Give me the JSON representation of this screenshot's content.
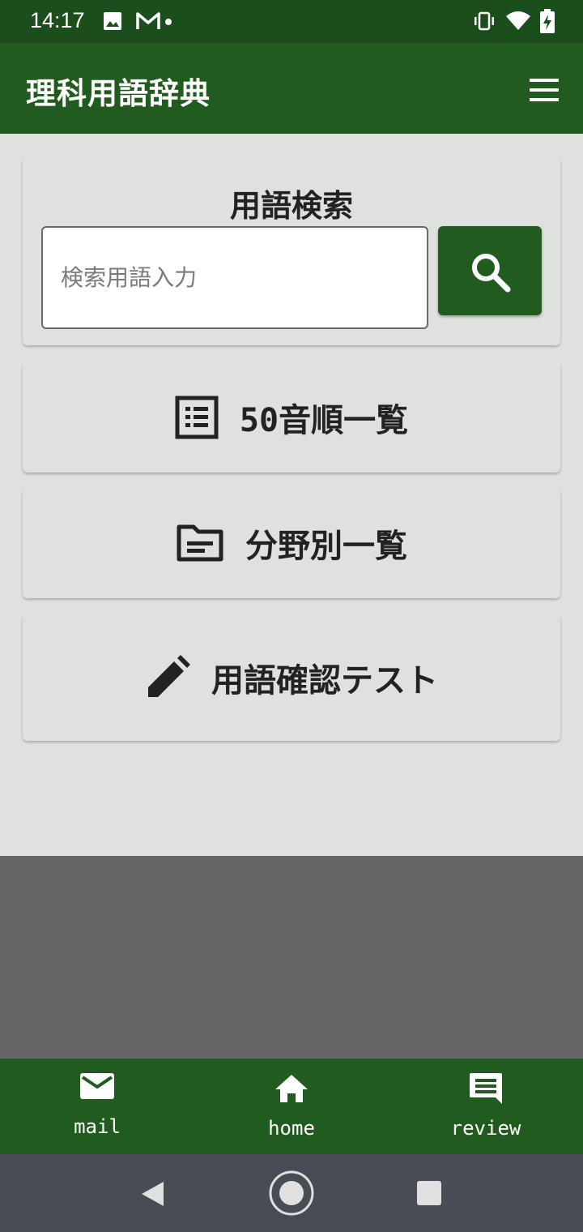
{
  "status_bar": {
    "time": "14:17",
    "icons": [
      "image-icon",
      "gmail-icon",
      "dot-icon",
      "vibrate-icon",
      "wifi-icon",
      "battery-charging-icon"
    ]
  },
  "app_bar": {
    "title": "理科用語辞典",
    "menu_icon": "hamburger-menu-icon"
  },
  "search": {
    "title": "用語検索",
    "placeholder": "検索用語入力",
    "value": "",
    "button_icon": "search-icon"
  },
  "menu": [
    {
      "label": "50音順一覧",
      "icon": "list-icon"
    },
    {
      "label": "分野別一覧",
      "icon": "folder-icon"
    },
    {
      "label": "用語確認テスト",
      "icon": "pencil-icon"
    }
  ],
  "bottom_nav": [
    {
      "label": "mail",
      "icon": "mail-icon"
    },
    {
      "label": "home",
      "icon": "home-icon"
    },
    {
      "label": "review",
      "icon": "comment-icon"
    }
  ],
  "system_nav": [
    "back-icon",
    "home-circle-icon",
    "recents-icon"
  ],
  "colors": {
    "primary": "#225b20",
    "status_bar": "#1b4d1d",
    "background": "#e1e1e1",
    "card": "#dfe1df",
    "gray_area": "#666567",
    "system_nav": "#474c55"
  }
}
